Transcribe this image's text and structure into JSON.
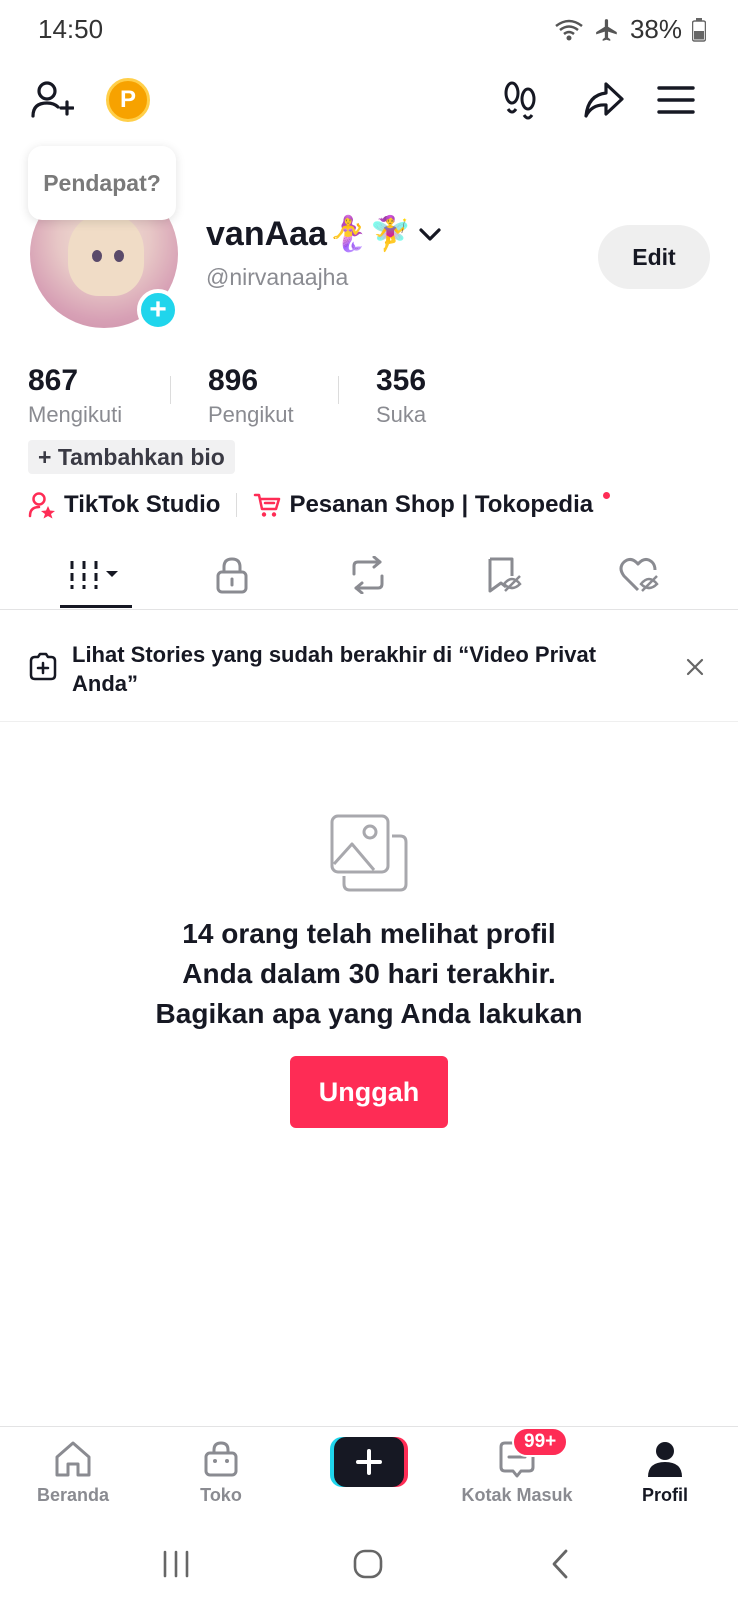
{
  "status_bar": {
    "time": "14:50",
    "battery": "38%"
  },
  "tooltip": {
    "text": "Pendapat?"
  },
  "profile": {
    "display_name": "vanAaa🧜‍♀️🧚‍♀️",
    "username": "@nirvanaajha",
    "edit_label": "Edit"
  },
  "stats": [
    {
      "value": "867",
      "label": "Mengikuti"
    },
    {
      "value": "896",
      "label": "Pengikut"
    },
    {
      "value": "356",
      "label": "Suka"
    }
  ],
  "bio_button": "+ Tambahkan bio",
  "links": {
    "studio": "TikTok Studio",
    "shop": "Pesanan Shop | Tokopedia"
  },
  "tabs": [
    "videos",
    "private",
    "reposts",
    "favorites",
    "liked"
  ],
  "banner": {
    "text": "Lihat Stories yang sudah berakhir di “Video Privat Anda”"
  },
  "empty_state": {
    "line1": "14 orang telah melihat profil",
    "line2": "Anda dalam 30 hari terakhir.",
    "line3": "Bagikan apa yang Anda lakukan",
    "button": "Unggah"
  },
  "bottom_nav": {
    "home": "Beranda",
    "shop": "Toko",
    "inbox": "Kotak Masuk",
    "inbox_badge": "99+",
    "profile": "Profil"
  },
  "colors": {
    "accent": "#fe2c55",
    "cyan": "#20d5ec",
    "text": "#161823",
    "muted": "#8a8b91"
  }
}
